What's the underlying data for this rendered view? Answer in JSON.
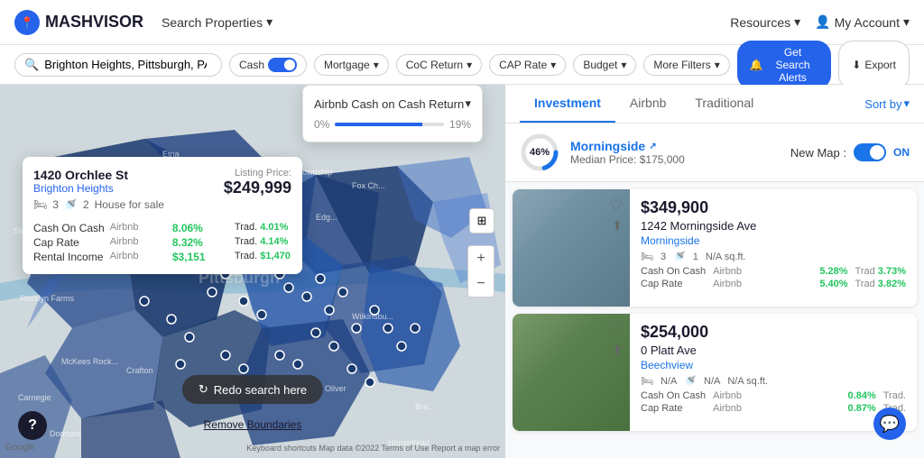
{
  "header": {
    "logo": "MASHVISOR",
    "logo_icon": "📍",
    "nav": [
      {
        "label": "Search Properties",
        "has_arrow": true
      },
      {
        "label": "Resources",
        "has_arrow": true
      }
    ],
    "account": "My Account"
  },
  "filter_bar": {
    "search_placeholder": "Brighton Heights, Pittsburgh, PA",
    "filters": [
      {
        "label": "Cash",
        "type": "toggle"
      },
      {
        "label": "Mortgage",
        "type": "dropdown"
      },
      {
        "label": "CoC Return",
        "type": "dropdown"
      },
      {
        "label": "CAP Rate",
        "type": "dropdown"
      },
      {
        "label": "Budget",
        "type": "dropdown"
      },
      {
        "label": "More Filters",
        "type": "dropdown"
      }
    ],
    "btn_alert": "Get Search Alerts",
    "btn_export": "Export"
  },
  "popup": {
    "address": "1420 Orchlee St",
    "neighborhood": "Brighton Heights",
    "beds": "3",
    "baths": "2",
    "type": "House for sale",
    "listing_price_label": "Listing Price:",
    "listing_price": "$249,999",
    "stats": [
      {
        "label": "Cash On Cash",
        "airbnb_label": "Airbnb",
        "airbnb_val": "8.06%",
        "trad_label": "Trad.",
        "trad_val": "4.01%"
      },
      {
        "label": "Cap Rate",
        "airbnb_label": "Airbnb",
        "airbnb_val": "8.32%",
        "trad_label": "Trad.",
        "trad_val": "4.14%"
      },
      {
        "label": "Rental Income",
        "airbnb_label": "Airbnb",
        "airbnb_val": "$3,151",
        "trad_label": "Trad.",
        "trad_val": "$1,470"
      }
    ]
  },
  "cap_rate_dropdown": {
    "title": "Airbnb Cash on Cash Return",
    "min": "0%",
    "max": "19%"
  },
  "tabs": [
    {
      "label": "Investment",
      "active": true
    },
    {
      "label": "Airbnb",
      "active": false
    },
    {
      "label": "Traditional",
      "active": false
    }
  ],
  "sort_by": "Sort by",
  "morningside": {
    "pct": "46%",
    "name": "Morningside",
    "median_label": "Median Price:",
    "median_price": "$175,000",
    "new_map_label": "New Map :",
    "toggle_state": "ON"
  },
  "properties": [
    {
      "price": "$349,900",
      "address": "1242 Morningside Ave",
      "neighborhood": "Morningside",
      "beds": "3",
      "baths": "1",
      "sqft": "N/A sq.ft.",
      "stats": [
        {
          "label": "Cash On Cash",
          "airbnb_label": "Airbnb",
          "airbnb_val": "5.28%",
          "trad_label": "Trad",
          "trad_val": "3.73%"
        },
        {
          "label": "Cap Rate",
          "airbnb_label": "Airbnb",
          "airbnb_val": "5.40%",
          "trad_label": "Trad",
          "trad_val": "3.82%"
        }
      ],
      "img_class": "img-1"
    },
    {
      "price": "$254,000",
      "address": "0 Platt Ave",
      "neighborhood": "Beechview",
      "beds": "N/A",
      "baths": "N/A",
      "sqft": "N/A sq.ft.",
      "stats": [
        {
          "label": "Cash On Cash",
          "airbnb_label": "Airbnb",
          "airbnb_val": "0.84%",
          "trad_label": "Trad.",
          "trad_val": ""
        },
        {
          "label": "Cap Rate",
          "airbnb_label": "Airbnb",
          "airbnb_val": "0.87%",
          "trad_label": "Trad.",
          "trad_val": ""
        }
      ],
      "img_class": "img-2"
    }
  ],
  "map": {
    "redo_search": "Redo search here",
    "remove_boundaries": "Remove Boundaries",
    "attribution": "Google",
    "attribution2": "Keyboard shortcuts  Map data ©2022  Terms of Use  Report a map error"
  },
  "help": "?",
  "chat_icon": "💬"
}
